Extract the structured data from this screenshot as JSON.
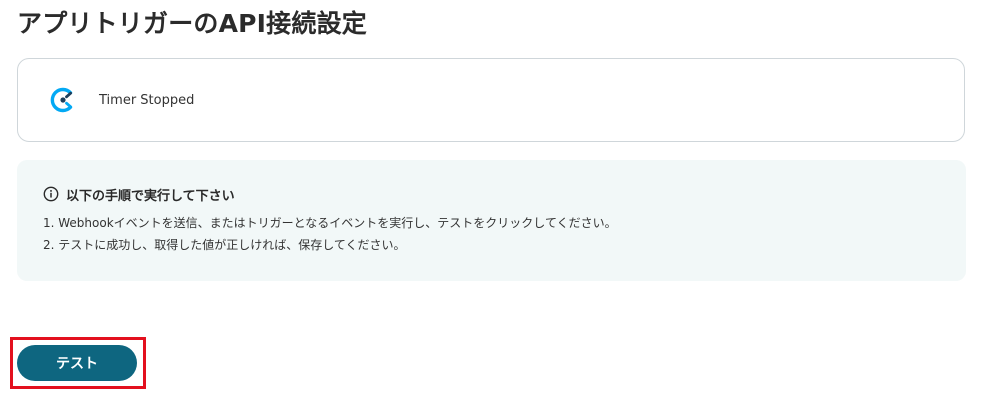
{
  "page": {
    "title": "アプリトリガーのAPI接続設定"
  },
  "trigger": {
    "icon": "clockify-clock-icon",
    "icon_color": "#03a9f4",
    "name": "Timer Stopped"
  },
  "instructions": {
    "icon": "info-icon",
    "heading": "以下の手順で実行して下さい",
    "steps": [
      "1. Webhookイベントを送信、またはトリガーとなるイベントを実行し、テストをクリックしてください。",
      "2. テストに成功し、取得した値が正しければ、保存してください。"
    ]
  },
  "actions": {
    "test_label": "テスト",
    "test_button_color": "#0e6680",
    "highlight_color": "#e3101e"
  }
}
